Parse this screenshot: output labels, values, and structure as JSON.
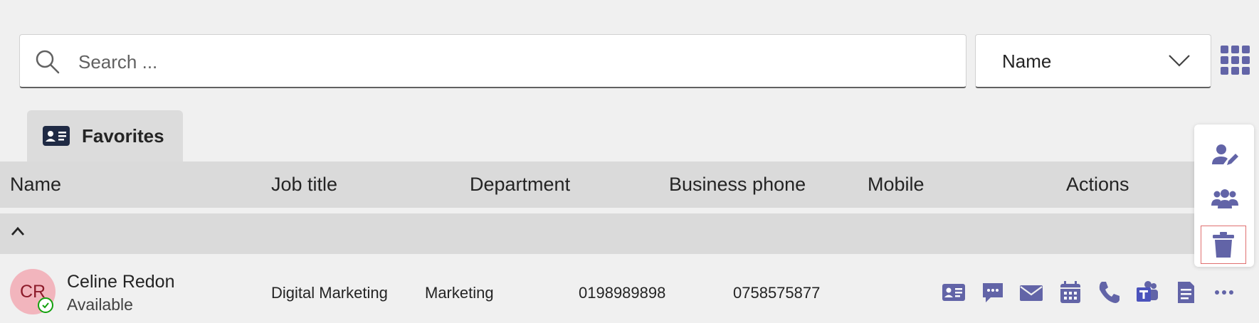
{
  "search": {
    "placeholder": "Search ..."
  },
  "sort": {
    "selected": "Name"
  },
  "tab": {
    "label": "Favorites"
  },
  "columns": [
    "Name",
    "Job title",
    "Department",
    "Business phone",
    "Mobile",
    "Actions"
  ],
  "contacts": [
    {
      "initials": "CR",
      "name": "Celine Redon",
      "status": "Available",
      "job_title": "Digital Marketing",
      "department": "Marketing",
      "business_phone": "0198989898",
      "mobile": "0758575877"
    }
  ],
  "row_actions": [
    "contact-card-icon",
    "chat-icon",
    "mail-icon",
    "calendar-icon",
    "phone-icon",
    "teams-icon",
    "notes-icon",
    "more-icon"
  ],
  "side_actions": [
    "edit-contact-icon",
    "group-icon",
    "delete-icon"
  ],
  "colors": {
    "accent": "#6264a7",
    "background": "#f0f0f0",
    "header": "#dadada",
    "avatar_bg": "#f2b5bd",
    "available": "#13a10e"
  }
}
